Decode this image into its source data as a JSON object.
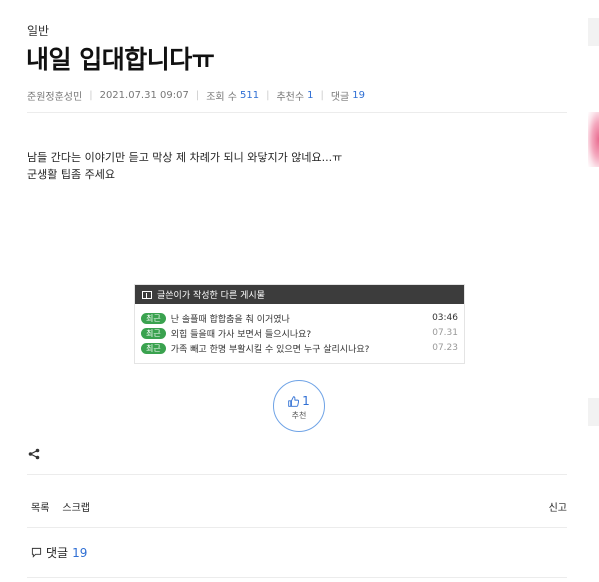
{
  "post": {
    "category": "일반",
    "title": "내일 입대합니다ㅠ",
    "author": "준원정훈성민",
    "datetime": "2021.07.31 09:07",
    "views_label": "조회 수",
    "views": "511",
    "recommend_label": "추천수",
    "recommend": "1",
    "comments_label": "댓글",
    "comments": "19",
    "body_lines": [
      "남들 간다는 이야기만 듣고 막상 제 차례가 되니 와닿지가 않네요...ㅠ",
      "군생활 팁좀 주세요"
    ]
  },
  "other_posts": {
    "heading": "글쓴이가 작성한 다른 게시물",
    "badge": "최근",
    "items": [
      {
        "title": "난 솔플때 합합춤을 춰 이거였나",
        "date": "03:46"
      },
      {
        "title": "외힙 들을때 가사 보면서 들으시나요?",
        "date": "07.31"
      },
      {
        "title": "가족 빼고 한명 부활시킬 수 있으면 누구 살리시나요?",
        "date": "07.23"
      }
    ]
  },
  "like": {
    "count": "1",
    "label": "추천"
  },
  "actions": {
    "list_label": "목록",
    "scrap_label": "스크랩",
    "report_label": "신고"
  },
  "comment_section": {
    "label": "댓글",
    "count": "19"
  },
  "icons": {
    "share": "share-icon",
    "thumbs_up": "thumbs-up-icon",
    "comment": "comment-icon",
    "list": "list-icon"
  },
  "colors": {
    "accent": "#2f6fd4",
    "badge": "#3aa24f",
    "header_bar": "#3c3c3c"
  }
}
